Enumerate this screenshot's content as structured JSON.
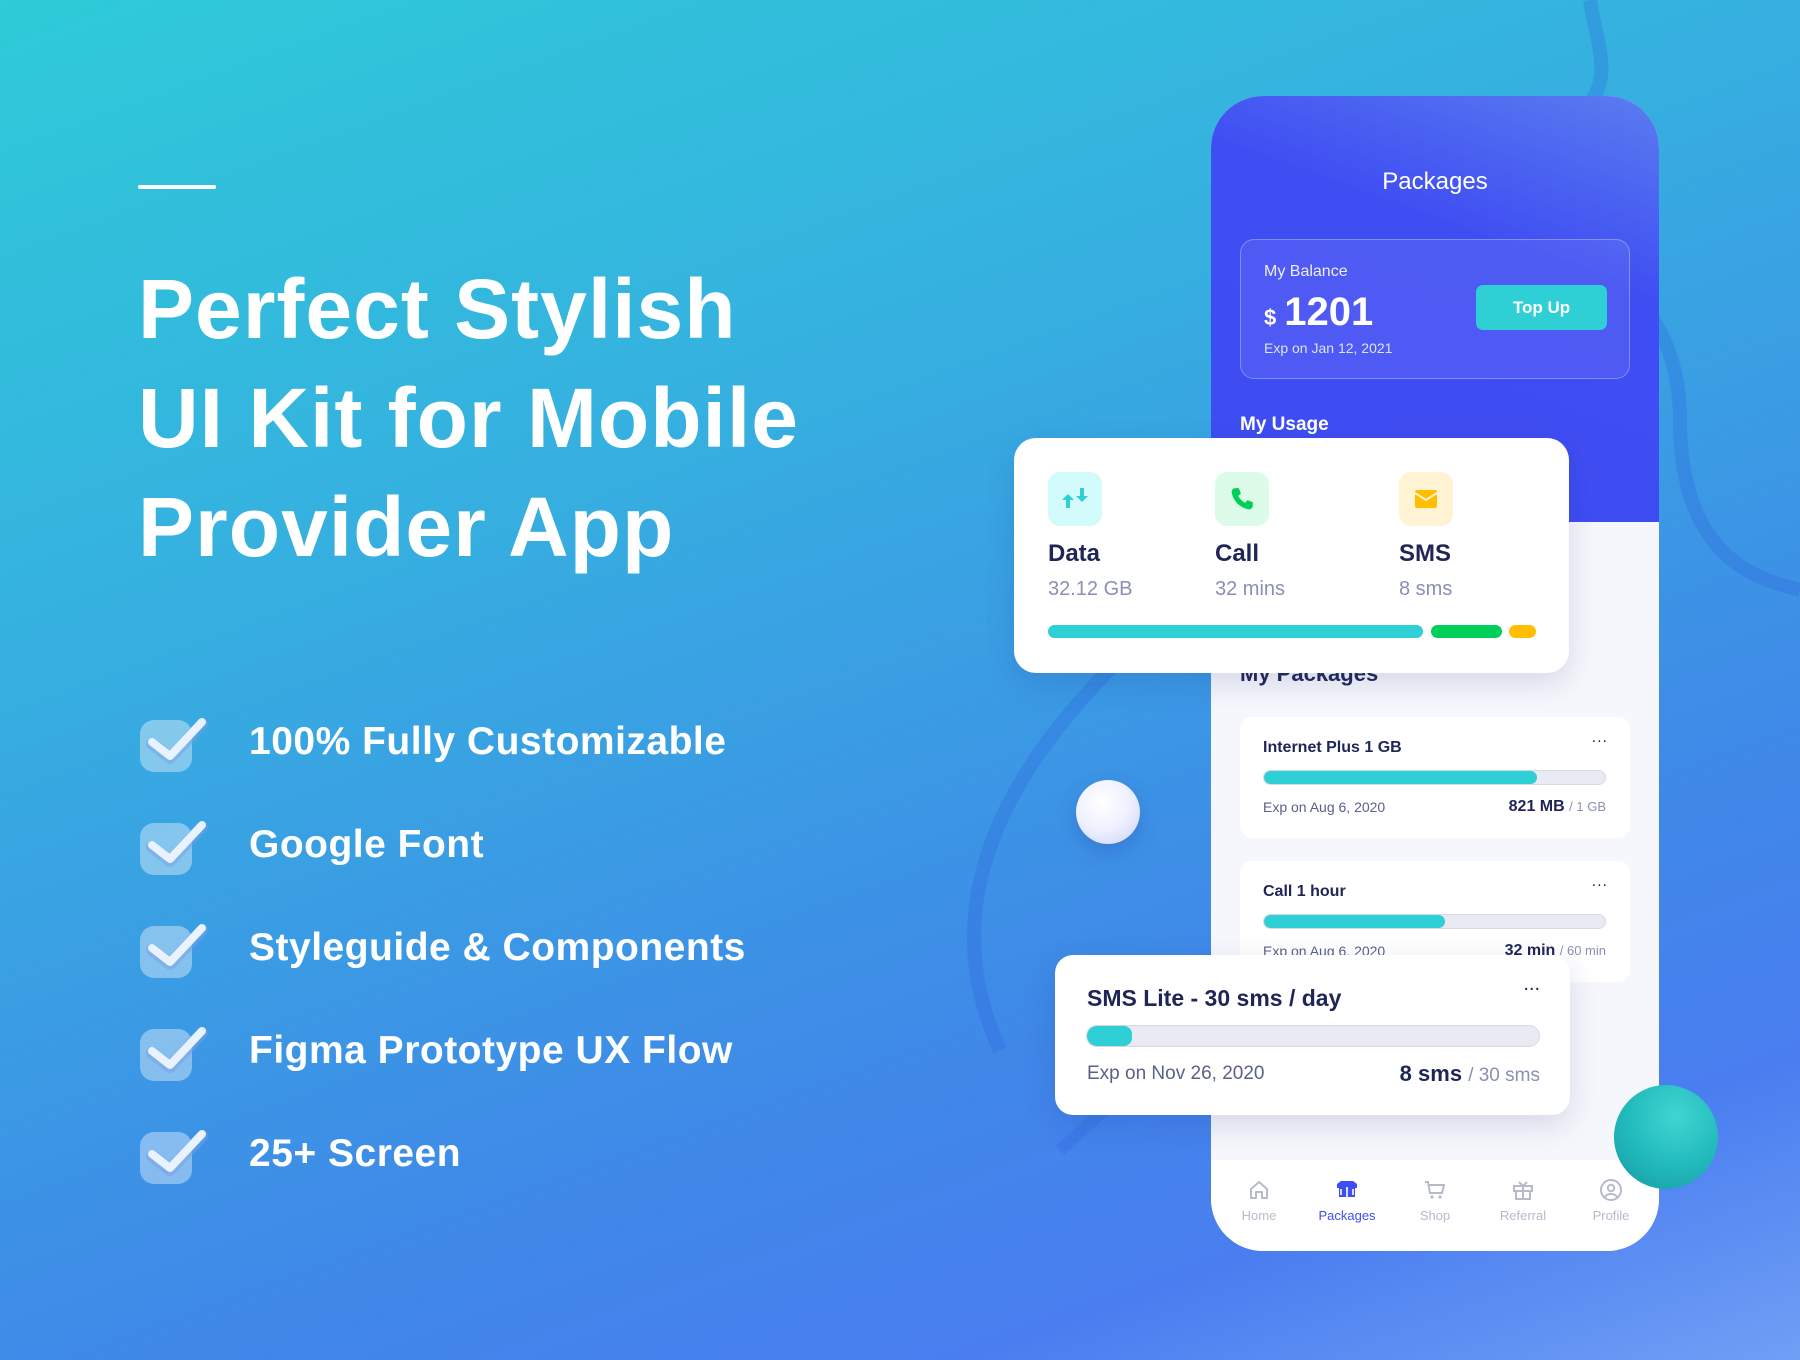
{
  "hero": {
    "headline_lines": [
      "Perfect Stylish",
      "UI Kit for Mobile",
      "Provider App"
    ],
    "features": [
      "100% Fully Customizable",
      "Google Font",
      "Styleguide & Components",
      "Figma Prototype UX Flow",
      "25+ Screen"
    ]
  },
  "phone": {
    "title": "Packages",
    "balance": {
      "label": "My Balance",
      "currency": "$",
      "amount": "1201",
      "expiry": "Exp on Jan 12, 2021",
      "top_up_label": "Top Up"
    },
    "my_usage_title": "My Usage",
    "usage": [
      {
        "name": "Data",
        "value": "32.12 GB",
        "icon": "data-transfer-icon",
        "color": "#2ecfd5"
      },
      {
        "name": "Call",
        "value": "32 mins",
        "icon": "phone-icon",
        "color": "#00d05a"
      },
      {
        "name": "SMS",
        "value": "8 sms",
        "icon": "envelope-icon",
        "color": "#ffbf00"
      }
    ],
    "my_packages_title": "My Packages",
    "packages": [
      {
        "name": "Internet Plus 1 GB",
        "expiry": "Exp on Aug 6, 2020",
        "used": "821 MB",
        "total": "/ 1 GB",
        "progress": 0.8
      },
      {
        "name": "Call 1 hour",
        "expiry": "Exp on Aug 6, 2020",
        "used": "32 min",
        "total": "/ 60 min",
        "progress": 0.53
      },
      {
        "name": "SMS Lite - 30 sms / day",
        "expiry": "Exp on Nov 26, 2020",
        "used": "8 sms",
        "total": "/ 30 sms",
        "progress": 0.1
      }
    ],
    "more_label": "...",
    "nav": [
      {
        "label": "Home",
        "icon": "home-icon"
      },
      {
        "label": "Packages",
        "icon": "box-icon",
        "active": true
      },
      {
        "label": "Shop",
        "icon": "cart-icon"
      },
      {
        "label": "Referral",
        "icon": "gift-icon"
      },
      {
        "label": "Profile",
        "icon": "user-circle-icon"
      }
    ]
  },
  "colors": {
    "accent": "#3f4ef2",
    "teal": "#2ecfd5",
    "green": "#00d05a",
    "yellow": "#ffbf00",
    "text_dark": "#1f2557"
  }
}
